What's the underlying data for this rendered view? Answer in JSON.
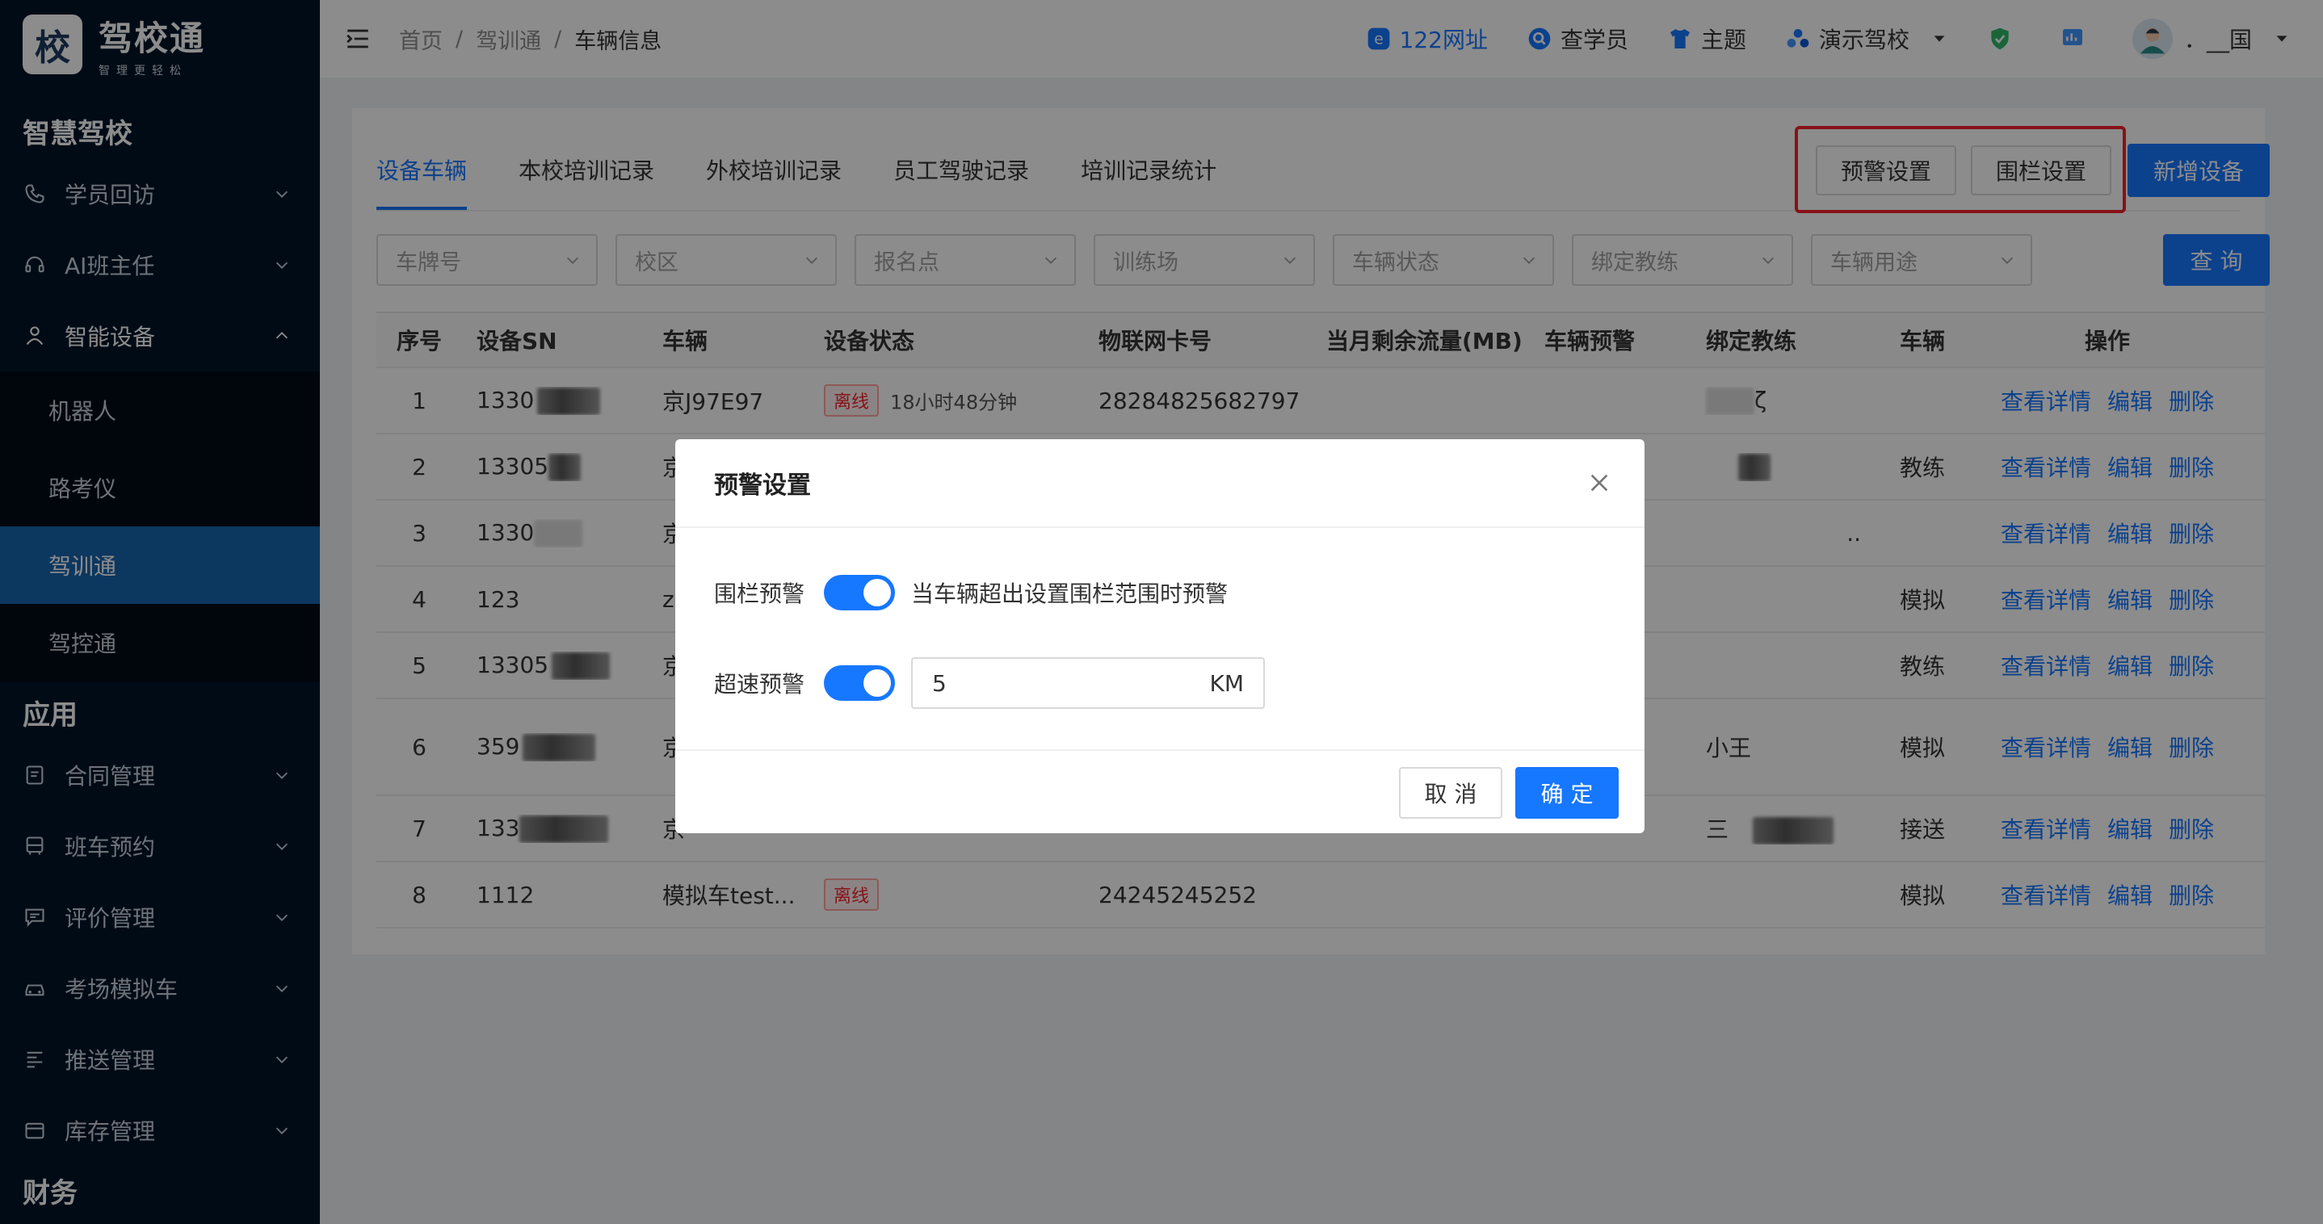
{
  "brand": {
    "logo_char": "校",
    "name": "驾校通",
    "tagline": "智理更轻松"
  },
  "sidebar": {
    "sections": [
      {
        "title": "智慧驾校"
      },
      {
        "title": "应用"
      },
      {
        "title": "财务"
      }
    ],
    "items": [
      {
        "label": "学员回访",
        "icon": "phone-icon"
      },
      {
        "label": "AI班主任",
        "icon": "headset-icon"
      },
      {
        "label": "智能设备",
        "icon": "user-icon"
      },
      {
        "label": "机器人"
      },
      {
        "label": "路考仪"
      },
      {
        "label": "驾训通"
      },
      {
        "label": "驾控通"
      },
      {
        "label": "合同管理",
        "icon": "contract-icon"
      },
      {
        "label": "班车预约",
        "icon": "bus-icon"
      },
      {
        "label": "评价管理",
        "icon": "comment-icon"
      },
      {
        "label": "考场模拟车",
        "icon": "car-icon"
      },
      {
        "label": "推送管理",
        "icon": "push-icon"
      },
      {
        "label": "库存管理",
        "icon": "inventory-icon"
      }
    ]
  },
  "header": {
    "breadcrumb": [
      "首页",
      "驾训通",
      "车辆信息"
    ],
    "sep": "/",
    "links": {
      "site": "122网址",
      "student": "查学员",
      "theme": "主题",
      "school": "演示驾校"
    },
    "user": "．__国"
  },
  "tabs": [
    "设备车辆",
    "本校培训记录",
    "外校培训记录",
    "员工驾驶记录",
    "培训记录统计"
  ],
  "buttons": {
    "warn": "预警设置",
    "fence": "围栏设置",
    "add": "新增设备",
    "query": "查 询"
  },
  "filters": [
    "车牌号",
    "校区",
    "报名点",
    "训练场",
    "车辆状态",
    "绑定教练",
    "车辆用途"
  ],
  "table": {
    "headers": [
      "序号",
      "设备SN",
      "车辆",
      "设备状态",
      "物联网卡号",
      "当月剩余流量(MB)",
      "车辆预警",
      "绑定教练",
      "车辆",
      "操作"
    ],
    "ops": [
      "查看详情",
      "编辑",
      "删除"
    ],
    "rows": [
      {
        "idx": "1",
        "sn": "1330",
        "car": "京J97E97",
        "status": "离线",
        "dur": "18小时48分钟",
        "sim": "28284825682797",
        "coach": "ζ",
        "use": ""
      },
      {
        "idx": "2",
        "sn": "13305",
        "car": "京",
        "status": "",
        "dur": "",
        "sim": "",
        "coach": "",
        "use": "教练"
      },
      {
        "idx": "3",
        "sn": "1330",
        "car": "京",
        "status": "",
        "dur": "",
        "sim": "",
        "coach": "..",
        "use": ""
      },
      {
        "idx": "4",
        "sn": "123",
        "car": "z",
        "status": "",
        "dur": "",
        "sim": "",
        "coach": "",
        "use": "模拟"
      },
      {
        "idx": "5",
        "sn": "13305",
        "car": "京",
        "status": "",
        "dur": "",
        "sim": "",
        "coach": "",
        "use": "教练"
      },
      {
        "idx": "6",
        "sn": "359",
        "car": "京",
        "status": "",
        "dur": "",
        "sim": "",
        "coach": "小王",
        "use": "模拟"
      },
      {
        "idx": "7",
        "sn": "133",
        "car": "京",
        "status": "",
        "dur": "",
        "sim": "",
        "coach": "三",
        "use": "接送"
      },
      {
        "idx": "8",
        "sn": "1112",
        "car": "模拟车test...",
        "status": "离线",
        "dur": "",
        "sim": "24245245252",
        "coach": "",
        "use": "模拟"
      }
    ]
  },
  "modal": {
    "title": "预警设置",
    "fence_label": "围栏预警",
    "fence_hint": "当车辆超出设置围栏范围时预警",
    "speed_label": "超速预警",
    "speed_value": "5",
    "speed_unit": "KM",
    "cancel": "取 消",
    "ok": "确 定"
  },
  "colors": {
    "sidebar_bg": "#001529",
    "active": "#1765ad",
    "primary": "#1677ff",
    "danger": "#f5222d"
  }
}
